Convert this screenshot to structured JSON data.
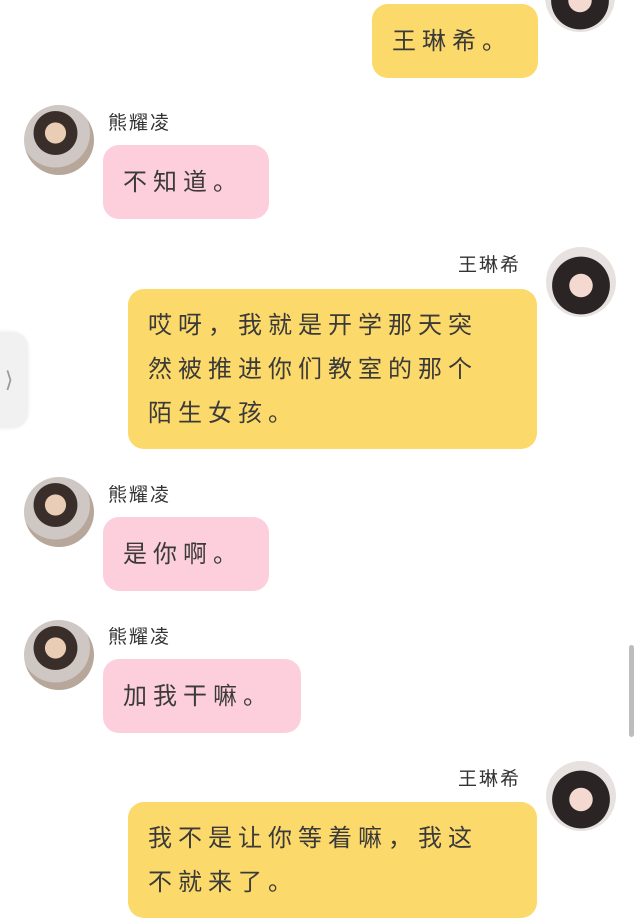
{
  "chat": {
    "partner_name": "熊耀凌",
    "self_name": "王琳希",
    "messages": [
      {
        "sender": "王琳希",
        "lines": [
          "王琳希。"
        ]
      },
      {
        "sender": "熊耀凌",
        "lines": [
          "不知道。"
        ]
      },
      {
        "sender": "王琳希",
        "lines": [
          "哎呀，我就是开学那天突",
          "然被推进你们教室的那个",
          "陌生女孩。"
        ]
      },
      {
        "sender": "熊耀凌",
        "lines": [
          "是你啊。"
        ]
      },
      {
        "sender": "熊耀凌",
        "lines": [
          "加我干嘛。"
        ]
      },
      {
        "sender": "王琳希",
        "lines": [
          "我不是让你等着嘛，我这",
          "不就来了。"
        ]
      }
    ]
  },
  "ui": {
    "side_handle_icon": "chevron-right-icon",
    "side_handle_glyph": "⟩",
    "colors": {
      "self_bubble": "#fcd96b",
      "partner_bubble": "#fdcfdc"
    }
  }
}
